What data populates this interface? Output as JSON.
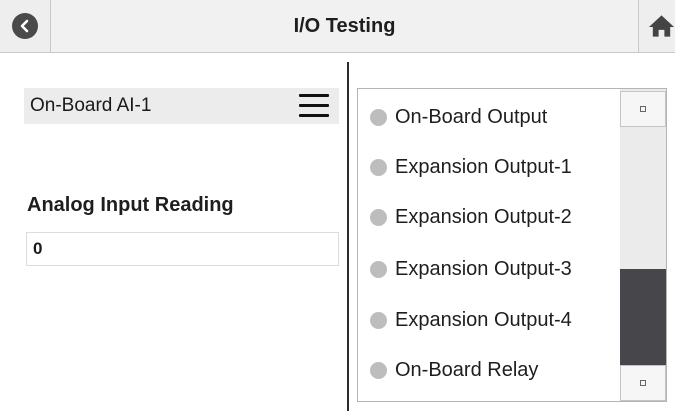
{
  "header": {
    "title": "I/O Testing",
    "back_icon": "chevron-left-icon",
    "home_icon": "home-icon"
  },
  "input_selector": {
    "selected": "On-Board AI-1",
    "menu_icon": "hamburger-menu-icon"
  },
  "reading": {
    "label": "Analog Input Reading",
    "value": "0"
  },
  "outputs": [
    {
      "label": "On-Board Output",
      "state": "off"
    },
    {
      "label": "Expansion Output-1",
      "state": "off"
    },
    {
      "label": "Expansion Output-2",
      "state": "off"
    },
    {
      "label": "Expansion Output-3",
      "state": "off"
    },
    {
      "label": "Expansion Output-4",
      "state": "off"
    },
    {
      "label": "On-Board Relay",
      "state": "off"
    }
  ],
  "colors": {
    "header_bg": "#f1f1f1",
    "indicator_off": "#bdbdbd",
    "scroll_thumb": "#47474b"
  }
}
